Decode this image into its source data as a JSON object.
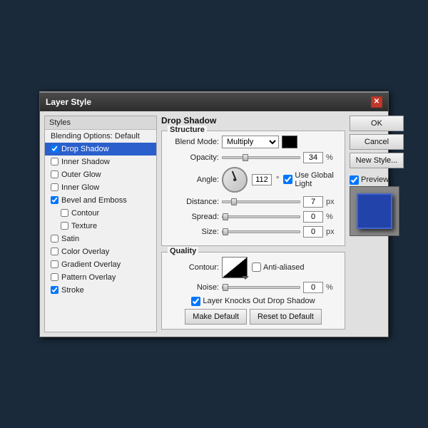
{
  "dialog": {
    "title": "Layer Style",
    "close_btn": "✕"
  },
  "left_panel": {
    "header": "Styles",
    "items": [
      {
        "id": "blending",
        "label": "Blending Options: Default",
        "checked": null,
        "active": false,
        "sub": false
      },
      {
        "id": "drop-shadow",
        "label": "Drop Shadow",
        "checked": true,
        "active": true,
        "sub": false
      },
      {
        "id": "inner-shadow",
        "label": "Inner Shadow",
        "checked": false,
        "active": false,
        "sub": false
      },
      {
        "id": "outer-glow",
        "label": "Outer Glow",
        "checked": false,
        "active": false,
        "sub": false
      },
      {
        "id": "inner-glow",
        "label": "Inner Glow",
        "checked": false,
        "active": false,
        "sub": false
      },
      {
        "id": "bevel-emboss",
        "label": "Bevel and Emboss",
        "checked": true,
        "active": false,
        "sub": false
      },
      {
        "id": "contour",
        "label": "Contour",
        "checked": false,
        "active": false,
        "sub": true
      },
      {
        "id": "texture",
        "label": "Texture",
        "checked": false,
        "active": false,
        "sub": true
      },
      {
        "id": "satin",
        "label": "Satin",
        "checked": false,
        "active": false,
        "sub": false
      },
      {
        "id": "color-overlay",
        "label": "Color Overlay",
        "checked": false,
        "active": false,
        "sub": false
      },
      {
        "id": "gradient-overlay",
        "label": "Gradient Overlay",
        "checked": false,
        "active": false,
        "sub": false
      },
      {
        "id": "pattern-overlay",
        "label": "Pattern Overlay",
        "checked": false,
        "active": false,
        "sub": false
      },
      {
        "id": "stroke",
        "label": "Stroke",
        "checked": true,
        "active": false,
        "sub": false
      }
    ]
  },
  "main": {
    "section_title": "Drop Shadow",
    "structure": {
      "label": "Structure",
      "blend_mode_label": "Blend Mode:",
      "blend_mode_value": "Multiply",
      "opacity_label": "Opacity:",
      "opacity_value": "34",
      "opacity_unit": "%",
      "opacity_pos": "30",
      "angle_label": "Angle:",
      "angle_value": "112",
      "angle_degree": "°",
      "global_light_label": "Use Global Light",
      "global_light_checked": true,
      "distance_label": "Distance:",
      "distance_value": "7",
      "distance_unit": "px",
      "distance_pos": "15",
      "spread_label": "Spread:",
      "spread_value": "0",
      "spread_unit": "%",
      "spread_pos": "0",
      "size_label": "Size:",
      "size_value": "0",
      "size_unit": "px",
      "size_pos": "0"
    },
    "quality": {
      "label": "Quality",
      "contour_label": "Contour:",
      "anti_aliased_label": "Anti-aliased",
      "anti_aliased_checked": false,
      "noise_label": "Noise:",
      "noise_value": "0",
      "noise_unit": "%",
      "noise_pos": "0",
      "knocks_out_label": "Layer Knocks Out Drop Shadow",
      "knocks_out_checked": true
    },
    "make_default_btn": "Make Default",
    "reset_default_btn": "Reset to Default"
  },
  "right_panel": {
    "ok_label": "OK",
    "cancel_label": "Cancel",
    "new_style_label": "New Style...",
    "preview_label": "Preview",
    "preview_checked": true
  }
}
